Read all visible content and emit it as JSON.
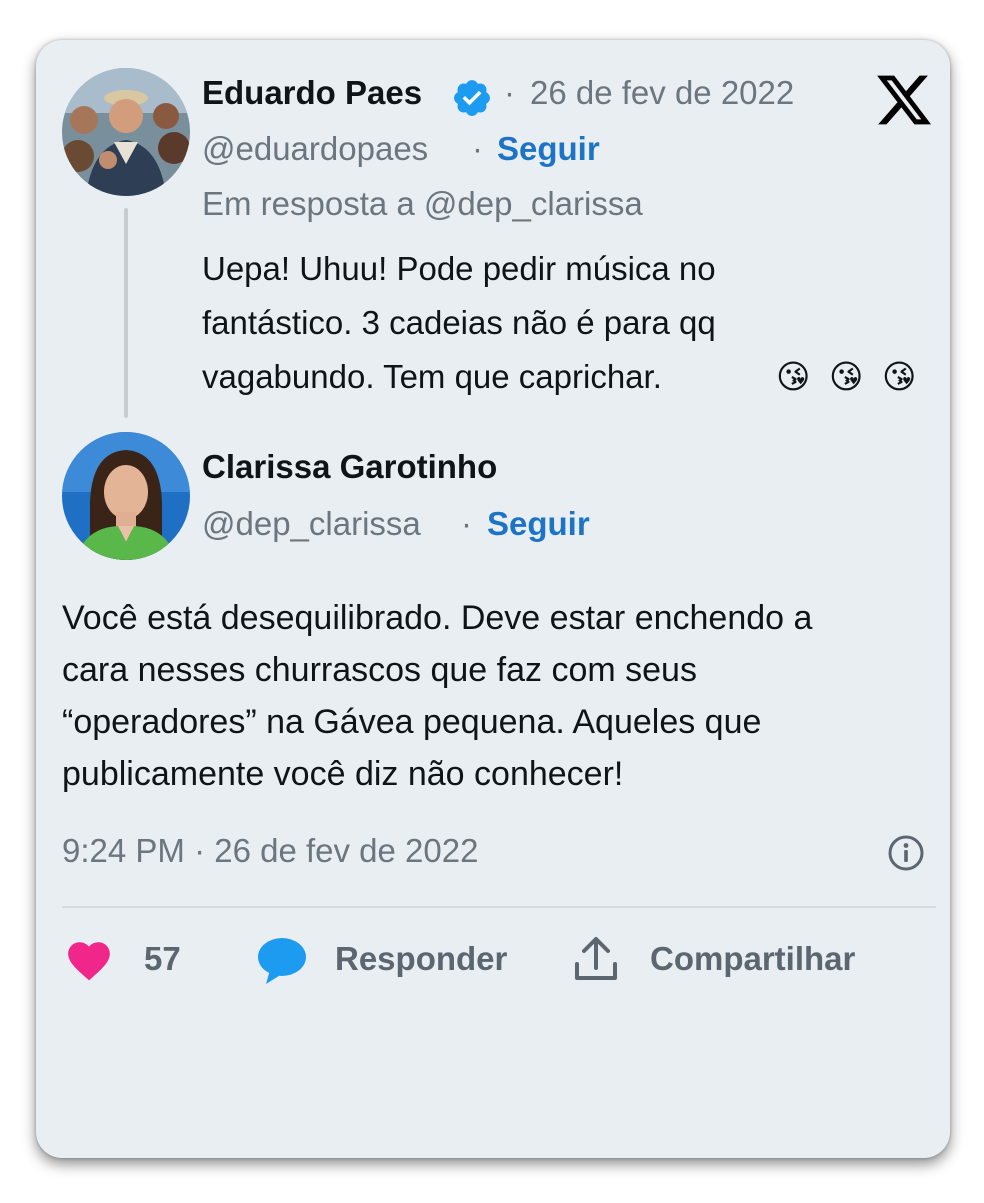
{
  "reply_tweet": {
    "author_name": "Eduardo Paes",
    "verified_icon": "verified-badge-icon",
    "date_separator": "·",
    "date": "26 de fev de 2022",
    "handle": "@eduardopaes",
    "follow_separator": "·",
    "follow_label": "Seguir",
    "in_reply_to": "Em resposta a @dep_clarissa",
    "text_lines": [
      "Uepa!   Uhuu!  Pode pedir música no",
      "fantástico.  3 cadeias não é para qq",
      "vagabundo.  Tem que caprichar."
    ],
    "emojis": [
      "😘",
      "😘",
      "😘"
    ]
  },
  "main_tweet": {
    "author_name": "Clarissa Garotinho",
    "handle": "@dep_clarissa",
    "follow_separator": "·",
    "follow_label": "Seguir",
    "text_lines": [
      "Você está desequilibrado. Deve estar enchendo a",
      "cara nesses churrascos que faz com seus",
      "“operadores” na Gávea pequena. Aqueles que",
      "publicamente você diz não conhecer!"
    ],
    "timestamp": "9:24 PM · 26 de fev de 2022"
  },
  "actions": {
    "like_count": "57",
    "reply_label": "Responder",
    "share_label": "Compartilhar"
  },
  "icons": {
    "logo": "x-logo-icon",
    "info": "info-icon",
    "like": "heart-icon",
    "reply": "speech-bubble-icon",
    "share": "share-upload-icon"
  },
  "colors": {
    "card_background": "#e9eef2",
    "follow_blue": "#1d74c4",
    "verified_blue": "#1d9bf0",
    "like_pink": "#f0268a",
    "reply_blue": "#1d9bf0",
    "muted_text": "#6b767f"
  }
}
